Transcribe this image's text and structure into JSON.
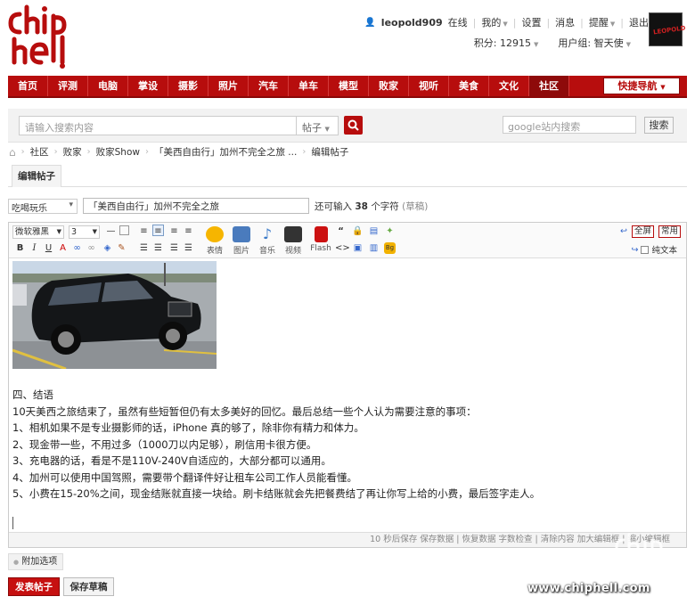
{
  "site": {
    "logo_text": "chiphell"
  },
  "user": {
    "name": "leopold909",
    "status": "在线",
    "links": [
      "我的",
      "设置",
      "消息",
      "提醒",
      "退出"
    ],
    "points_label": "积分: 12915",
    "group_label": "用户组: 智天使",
    "avatar_text": "LEOPOLD"
  },
  "nav": {
    "items": [
      "首页",
      "评测",
      "电脑",
      "掌设",
      "摄影",
      "照片",
      "汽车",
      "单车",
      "模型",
      "败家",
      "视听",
      "美食",
      "文化",
      "社区"
    ],
    "active": "社区",
    "quick_nav": "快捷导航"
  },
  "search": {
    "placeholder": "请输入搜索内容",
    "type": "帖子",
    "google_placeholder": "google站内搜索",
    "google_button": "搜索"
  },
  "breadcrumb": [
    "社区",
    "败家",
    "败家Show",
    "「美西自由行」加州不完全之旅 ...",
    "编辑帖子"
  ],
  "tab": {
    "label": "编辑帖子"
  },
  "subject": {
    "category": "吃喝玩乐",
    "value": "「美西自由行」加州不完全之旅",
    "hint_prefix": "还可输入",
    "hint_count": "38",
    "hint_suffix": "个字符",
    "draft_label": "(草稿)"
  },
  "toolbar": {
    "font": "微软雅黑",
    "size": "3",
    "big_buttons": [
      "表情",
      "图片",
      "音乐",
      "视频",
      "Flash"
    ],
    "fullscreen": "全屏",
    "common": "常用",
    "plain_text": "纯文本"
  },
  "content": {
    "heading": "四、结语",
    "lines": [
      "10天美西之旅结束了，虽然有些短暂但仍有太多美好的回忆。最后总结一些个人认为需要注意的事项：",
      "1、相机如果不是专业摄影师的话，iPhone 真的够了，除非你有精力和体力。",
      "2、现金带一些，不用过多（1000刀以内足够），刷信用卡很方便。",
      "3、充电器的话，看是不是110V-240V自适应的，大部分都可以通用。",
      "4、加州可以使用中国驾照，需要带个翻译件好让租车公司工作人员能看懂。",
      "5、小费在15-20%之间，现金结账就直接一块给。刷卡结账就会先把餐费结了再让你写上给的小费，最后签字走人。"
    ]
  },
  "status_bar": {
    "text": "10 秒后保存 保存数据 | 恢复数据    字数检查 | 清除内容    加大编辑框 | 缩小编辑框"
  },
  "attach": {
    "label": "附加选项"
  },
  "buttons": {
    "post": "发表帖子",
    "draft": "保存草稿"
  },
  "watermark": {
    "text": "www.chiphell.com"
  },
  "colors": {
    "brand": "#b70d0d",
    "nav_active": "#8e0a0a"
  }
}
